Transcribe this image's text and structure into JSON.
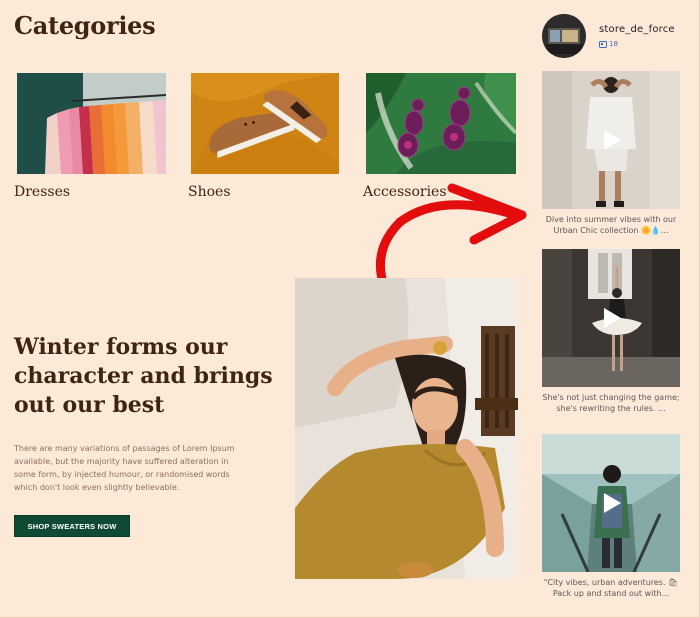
{
  "categories": {
    "title": "Categories",
    "items": [
      {
        "label": "Dresses"
      },
      {
        "label": "Shoes"
      },
      {
        "label": "Accessories"
      }
    ]
  },
  "hero": {
    "headline": "Winter forms our character and brings out our best",
    "body": "There are many variations of passages of Lorem Ipsum available, but the majority have suffered alteration in some form, by injected humour, or randomised words which don't look even slightly believable.",
    "button_label": "SHOP SWEATERS NOW"
  },
  "feed": {
    "profile_name": "store_de_force",
    "follower_count": "18",
    "posts": [
      {
        "caption": "Dive into summer vibes with our Urban Chic collection 🌼💧..."
      },
      {
        "caption": "She's not just changing the game; she's rewriting the rules. ..."
      },
      {
        "caption": "\"City vibes, urban adventures. 🛍 Pack up and stand out with..."
      }
    ]
  },
  "colors": {
    "background": "#fde9d8",
    "heading": "#3e2412",
    "button": "#0f4a34",
    "arrow": "#e30d0d"
  }
}
